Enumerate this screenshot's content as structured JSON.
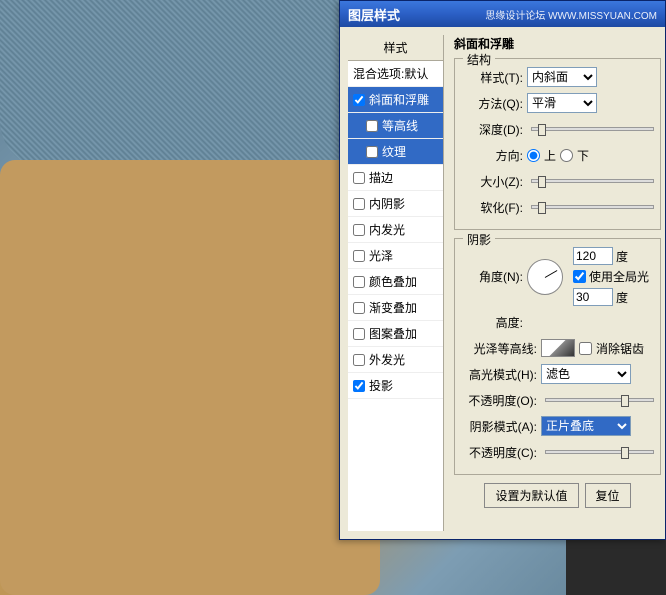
{
  "dialog": {
    "title": "图层样式",
    "watermark": "思缘设计论坛  WWW.MISSYUAN.COM"
  },
  "styleList": {
    "header": "样式",
    "blendHeader": "混合选项:默认",
    "items": [
      {
        "label": "斜面和浮雕",
        "checked": true,
        "selected": true,
        "child": false
      },
      {
        "label": "等高线",
        "checked": false,
        "selected": true,
        "child": true
      },
      {
        "label": "纹理",
        "checked": false,
        "selected": true,
        "child": true
      },
      {
        "label": "描边",
        "checked": false,
        "selected": false,
        "child": false
      },
      {
        "label": "内阴影",
        "checked": false,
        "selected": false,
        "child": false
      },
      {
        "label": "内发光",
        "checked": false,
        "selected": false,
        "child": false
      },
      {
        "label": "光泽",
        "checked": false,
        "selected": false,
        "child": false
      },
      {
        "label": "颜色叠加",
        "checked": false,
        "selected": false,
        "child": false
      },
      {
        "label": "渐变叠加",
        "checked": false,
        "selected": false,
        "child": false
      },
      {
        "label": "图案叠加",
        "checked": false,
        "selected": false,
        "child": false
      },
      {
        "label": "外发光",
        "checked": false,
        "selected": false,
        "child": false
      },
      {
        "label": "投影",
        "checked": true,
        "selected": false,
        "child": false
      }
    ]
  },
  "settings": {
    "pageTitle": "斜面和浮雕",
    "structGroup": "结构",
    "styleLabel": "样式(T):",
    "styleValue": "内斜面",
    "methodLabel": "方法(Q):",
    "methodValue": "平滑",
    "depthLabel": "深度(D):",
    "directionLabel": "方向:",
    "dirUp": "上",
    "dirDown": "下",
    "sizeLabel": "大小(Z):",
    "softenLabel": "软化(F):",
    "shadowGroup": "阴影",
    "angleLabel": "角度(N):",
    "angleValue": "120",
    "angleUnit": "度",
    "useGlobal": "使用全局光",
    "altitudeLabel": "高度:",
    "altitudeValue": "30",
    "altitudeUnit": "度",
    "glossLabel": "光泽等高线:",
    "antialias": "消除锯齿",
    "highlightLabel": "高光模式(H):",
    "highlightValue": "滤色",
    "opacity1Label": "不透明度(O):",
    "shadowModeLabel": "阴影模式(A):",
    "shadowModeValue": "正片叠底",
    "opacity2Label": "不透明度(C):",
    "defaultBtn": "设置为默认值",
    "resetBtn": "复位"
  }
}
